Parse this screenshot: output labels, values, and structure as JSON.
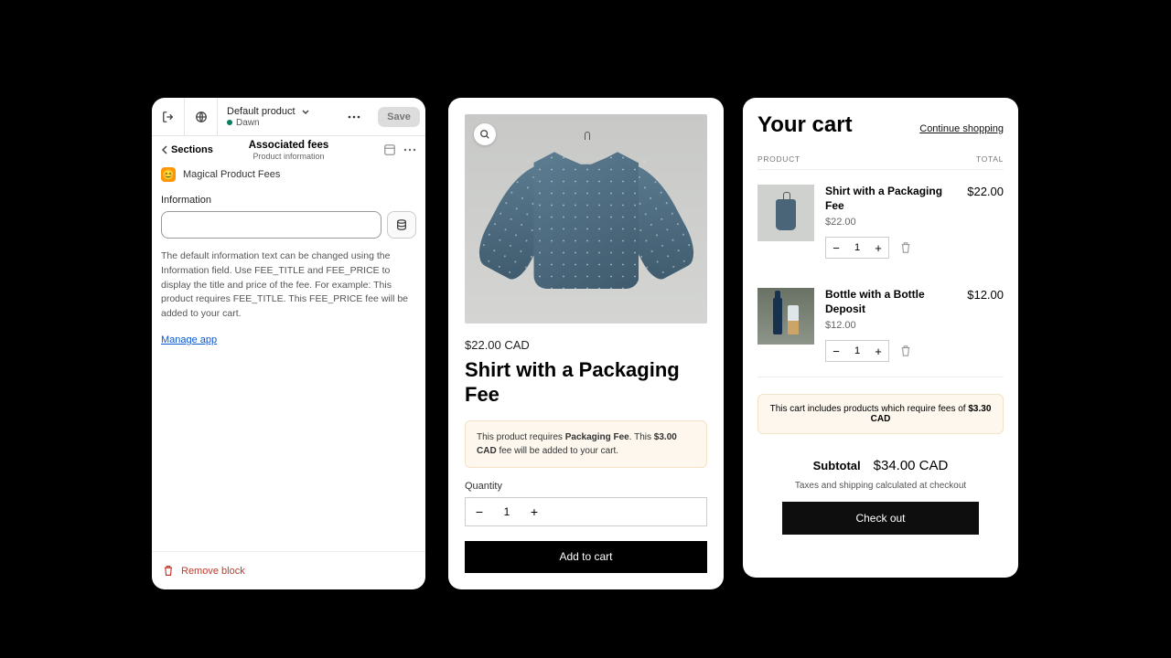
{
  "editor": {
    "product_selector": {
      "label": "Default product",
      "theme": "Dawn"
    },
    "save_label": "Save",
    "back_label": "Sections",
    "section_title": "Associated fees",
    "section_subtitle": "Product information",
    "app_name": "Magical Product Fees",
    "info_heading": "Information",
    "info_placeholder": "",
    "help_text": "The default information text can be changed using the Information field. Use FEE_TITLE and FEE_PRICE to display the title and price of the fee. For example: This product requires FEE_TITLE. This FEE_PRICE fee will be added to your cart.",
    "manage_app_label": "Manage app",
    "remove_block_label": "Remove block"
  },
  "product": {
    "price": "$22.00 CAD",
    "title": "Shirt with a Packaging Fee",
    "fee_note_pre": "This product requires ",
    "fee_note_title": "Packaging Fee",
    "fee_note_mid": ". This ",
    "fee_note_price": "$3.00 CAD",
    "fee_note_post": " fee will be added to your cart.",
    "qty_label": "Quantity",
    "qty": "1",
    "add_to_cart_label": "Add to cart"
  },
  "cart": {
    "title": "Your cart",
    "continue_label": "Continue shopping",
    "col_product": "PRODUCT",
    "col_total": "TOTAL",
    "items": [
      {
        "name": "Shirt with a Packaging Fee",
        "price": "$22.00",
        "qty": "1",
        "total": "$22.00"
      },
      {
        "name": "Bottle with a Bottle Deposit",
        "price": "$12.00",
        "qty": "1",
        "total": "$12.00"
      }
    ],
    "fees_note_pre": "This cart includes products which require fees of ",
    "fees_note_amount": "$3.30 CAD",
    "subtotal_label": "Subtotal",
    "subtotal_value": "$34.00 CAD",
    "tax_note": "Taxes and shipping calculated at checkout",
    "checkout_label": "Check out"
  }
}
